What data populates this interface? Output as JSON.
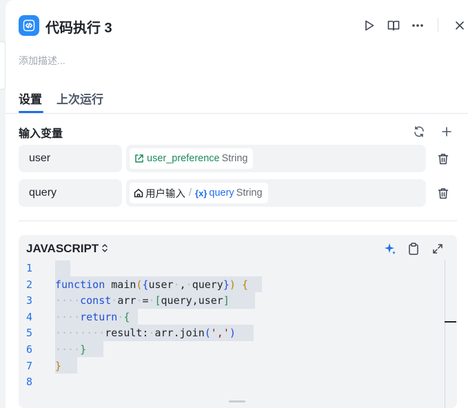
{
  "header": {
    "title": "代码执行 3",
    "description_placeholder": "添加描述..."
  },
  "tabs": [
    {
      "label": "设置",
      "active": true
    },
    {
      "label": "上次运行",
      "active": false
    }
  ],
  "inputs": {
    "section_title": "输入变量",
    "rows": [
      {
        "name": "user",
        "value_icon": "variable-link-icon",
        "value": "user_preference",
        "type": "String"
      },
      {
        "name": "query",
        "source_icon": "home-icon",
        "source": "用户输入",
        "separator": "/",
        "value_icon": "variable-icon",
        "value": "query",
        "type": "String"
      }
    ]
  },
  "code": {
    "language": "JAVASCRIPT",
    "line_numbers": [
      "1",
      "2",
      "3",
      "4",
      "5",
      "6",
      "7",
      "8"
    ],
    "lines": [
      "",
      "function main({user, query}) {",
      "    const arr = [query,user]",
      "    return {",
      "        result: arr.join(',')",
      "    }",
      "}",
      ""
    ]
  },
  "colors": {
    "accent": "#1f6feb",
    "node_icon_bg": "#2a8cf7",
    "variable_green": "#1b8a5a"
  }
}
